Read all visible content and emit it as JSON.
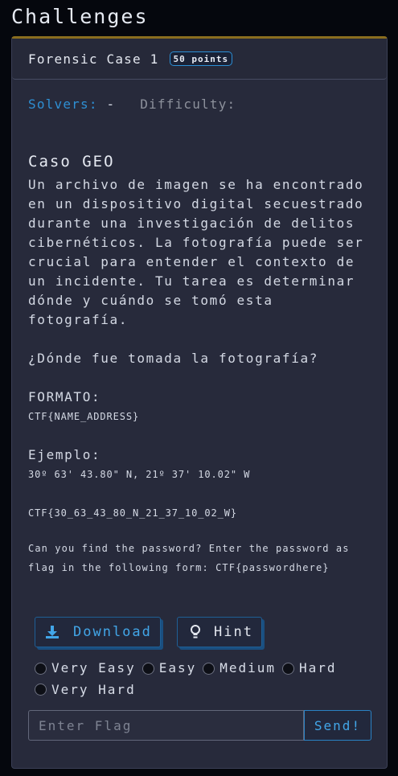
{
  "page": {
    "title": "Challenges"
  },
  "challenge": {
    "name": "Forensic Case 1",
    "points": "50 points",
    "solvers_label": "Solvers:",
    "solvers_value": "-",
    "difficulty_label": "Difficulty:",
    "case_title": "Caso GEO",
    "description": "Un archivo de imagen se ha encontrado en un dispositivo digital secuestrado durante una investigación de delitos cibernéticos. La fotografía puede ser crucial para entender el contexto de un incidente. Tu tarea es determinar dónde y cuándo se tomó esta fotografía.",
    "question": "¿Dónde fue tomada la fotografía?",
    "formato_label": "FORMATO:",
    "formato_value": "CTF{NAME_ADDRESS}",
    "ejemplo_label": "Ejemplo:",
    "ejemplo_coords": "30º 63' 43.80\" N, 21º 37' 10.02\" W",
    "ejemplo_flag": "CTF{30_63_43_80_N_21_37_10_02_W}",
    "password_note": "Can you find the password? Enter the password as flag in the following form: CTF{passwordhere}"
  },
  "actions": {
    "download_label": "Download",
    "hint_label": "Hint",
    "download_icon": "download-icon",
    "hint_icon": "lightbulb-icon"
  },
  "difficulty_options": [
    "Very Easy",
    "Easy",
    "Medium",
    "Hard",
    "Very Hard"
  ],
  "flag_form": {
    "placeholder": "Enter Flag",
    "value": "",
    "send_label": "Send!"
  },
  "colors": {
    "accent_blue": "#2e8fd3",
    "card_top_border": "#8a6d1f",
    "card_background": "#272a3b",
    "page_background": "#05070d"
  }
}
